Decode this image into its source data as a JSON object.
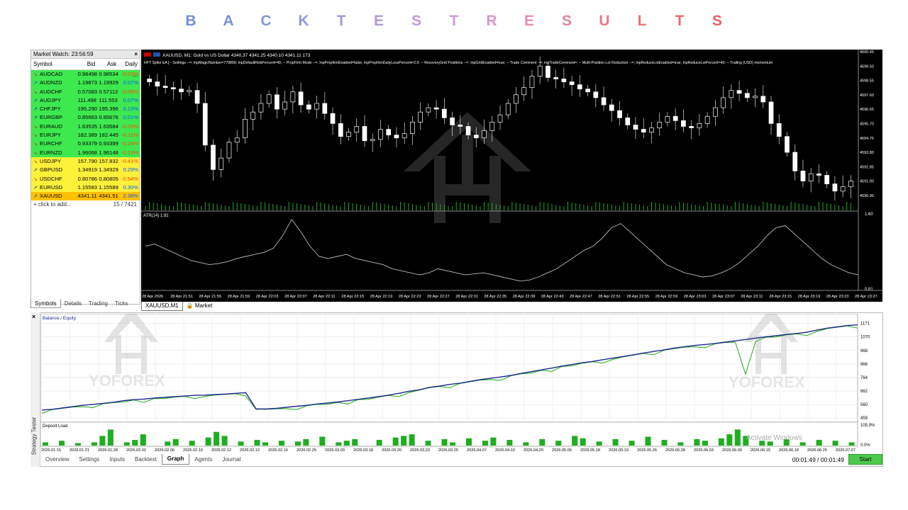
{
  "page_title": [
    "B",
    "A",
    "C",
    "K",
    "T",
    "E",
    "S",
    "T",
    "R",
    "E",
    "S",
    "U",
    "L",
    "T",
    "S"
  ],
  "title_colors": [
    "#6f8fd8",
    "#7593d8",
    "#8198d8",
    "#9097d8",
    "#9e98d8",
    "#b09ad8",
    "#c19ad8",
    "#cf99d8",
    "#d896cc",
    "#e08fb4",
    "#e4869c",
    "#e67c86",
    "#e87373",
    "#ea6a6a",
    "#ec6262"
  ],
  "market_watch": {
    "title": "Market Watch: 23:56:59",
    "close_icon": "×",
    "columns": [
      "Symbol",
      "Bid",
      "Ask",
      "Daily ..."
    ],
    "rows": [
      {
        "symbol": "AUDCAD",
        "bid": "0.98498",
        "ask": "0.98534",
        "chg": "-0.03%",
        "color": "g",
        "dir": "↘"
      },
      {
        "symbol": "AUDNZD",
        "bid": "1.19873",
        "ask": "1.19929",
        "chg": "0.07%",
        "color": "g",
        "dir": "↗"
      },
      {
        "symbol": "AUDCHF",
        "bid": "0.57083",
        "ask": "0.57112",
        "chg": "-0.06%",
        "color": "g",
        "dir": "↘"
      },
      {
        "symbol": "AUDJPY",
        "bid": "111.498",
        "ask": "111.553",
        "chg": "0.07%",
        "color": "g",
        "dir": "↗"
      },
      {
        "symbol": "CHFJPY",
        "bid": "195.290",
        "ask": "195.396",
        "chg": "0.13%",
        "color": "g",
        "dir": "↗"
      },
      {
        "symbol": "EURGBP",
        "bid": "0.85663",
        "ask": "0.85676",
        "chg": "0.01%",
        "color": "g",
        "dir": "↗"
      },
      {
        "symbol": "EURAUD",
        "bid": "1.63535",
        "ask": "1.63584",
        "chg": "-0.20%",
        "color": "g",
        "dir": "↘"
      },
      {
        "symbol": "EURJPY",
        "bid": "182.389",
        "ask": "182.445",
        "chg": "-0.11%",
        "color": "g",
        "dir": "↘"
      },
      {
        "symbol": "EURCHF",
        "bid": "0.93379",
        "ask": "0.93399",
        "chg": "-0.24%",
        "color": "g",
        "dir": "↘"
      },
      {
        "symbol": "EURNZD",
        "bid": "1.96068",
        "ask": "1.96148",
        "chg": "-0.13%",
        "color": "g",
        "dir": "↘"
      },
      {
        "symbol": "USDJPY",
        "bid": "157.790",
        "ask": "157.832",
        "chg": "-0.41%",
        "color": "y",
        "dir": "↘"
      },
      {
        "symbol": "GBPUSD",
        "bid": "1.34919",
        "ask": "1.34929",
        "chg": "0.29%",
        "color": "y",
        "dir": "↗"
      },
      {
        "symbol": "USDCHF",
        "bid": "0.80786",
        "ask": "0.80805",
        "chg": "-0.54%",
        "color": "y",
        "dir": "↘"
      },
      {
        "symbol": "EURUSD",
        "bid": "1.15583",
        "ask": "1.15589",
        "chg": "0.30%",
        "color": "y",
        "dir": "↗"
      },
      {
        "symbol": "XAUUSD",
        "bid": "4341.11",
        "ask": "4341.51",
        "chg": "2.38%",
        "color": "o",
        "dir": "↗"
      }
    ],
    "add_label": "+  click to add...",
    "count": "15 / 7421",
    "tabs": [
      "Symbols",
      "Details",
      "Trading",
      "Ticks"
    ]
  },
  "chart": {
    "header": "XAUUSD, M1:  Gold vs US Dollar  4340.37 4341.25 4340.10 4341.11  173",
    "ea_line": "HFT Spike EA [-- Settings --=; InpMagicNumber=779899; InpDefaultRiskPercent=40; -- PropFirm Mode --=; InpPropfirmEnabled=false; InpPropfirmDailyLossPercent=2.0; -- RecoveryGrid Positions --=; InpGridEnabled=true; -- Trade Comment --=; InpTradeComment=; -- Multi-Position Lot Reduction --=; InpReduceLotEnabled=true; InpReduceLotPercent=40; -- Trailing (USD) momentum",
    "price_labels": [
      "4600.45",
      "4599.50",
      "4598.55",
      "4597.60",
      "4596.65",
      "4595.70",
      "4594.75",
      "4593.80",
      "4592.85",
      "4591.90",
      "4590.95"
    ],
    "atr_label": "ATR(14) 1.92",
    "atr_scale": [
      "1.60",
      "0.81"
    ],
    "time_labels": [
      "28 Apr 2026",
      "28 Apr 21:51",
      "28 Apr 21:55",
      "28 Apr 21:59",
      "28 Apr 22:03",
      "28 Apr 22:07",
      "28 Apr 22:11",
      "28 Apr 22:15",
      "28 Apr 22:19",
      "28 Apr 22:23",
      "28 Apr 22:27",
      "28 Apr 22:31",
      "28 Apr 22:35",
      "28 Apr 22:39",
      "28 Apr 22:43",
      "28 Apr 22:47",
      "28 Apr 22:51",
      "28 Apr 22:55",
      "28 Apr 22:59",
      "28 Apr 23:03",
      "28 Apr 23:07",
      "28 Apr 23:11",
      "28 Apr 23:15",
      "28 Apr 23:19",
      "28 Apr 23:23",
      "28 Apr 23:27"
    ],
    "tabs": [
      "XAUUSD,M1",
      "Market"
    ],
    "candle_closes": [
      4598.7,
      4598.4,
      4598.3,
      4598.2,
      4598.0,
      4598.1,
      4597.2,
      4594.3,
      4592.6,
      4593.4,
      4594.5,
      4594.8,
      4596.1,
      4596.6,
      4597.2,
      4597.8,
      4596.8,
      4597.3,
      4598.0,
      4597.1,
      4596.8,
      4597.2,
      4596.5,
      4595.8,
      4594.9,
      4595.2,
      4595.6,
      4594.6,
      4594.7,
      4595.4,
      4595.0,
      4594.8,
      4595.1,
      4595.9,
      4596.6,
      4596.9,
      4596.8,
      4596.2,
      4595.7,
      4595.6,
      4595.0,
      4594.8,
      4595.3,
      4595.9,
      4596.4,
      4597.2,
      4597.8,
      4598.3,
      4599.1,
      4599.8,
      4599.0,
      4598.9,
      4598.7,
      4598.5,
      4598.2,
      4598.0,
      4597.6,
      4597.1,
      4596.7,
      4596.2,
      4595.7,
      4595.4,
      4595.2,
      4595.5,
      4595.9,
      4596.3,
      4596.0,
      4595.6,
      4595.5,
      4595.8,
      4596.3,
      4596.9,
      4597.6,
      4598.1,
      4597.9,
      4597.6,
      4597.7,
      4597.3,
      4595.8,
      4594.9,
      4593.8,
      4592.5,
      4591.8,
      4592.3,
      4592.2,
      4591.6,
      4591.1,
      4591.4,
      4591.8
    ]
  },
  "tester": {
    "side_label": "Strategy Tester",
    "close_icon": "×",
    "legend": "Balance / Equity",
    "balance_scale": [
      "1171",
      "1070",
      "968",
      "866",
      "764",
      "662",
      "560",
      "459"
    ],
    "deposit_label": "Deposit Load",
    "deposit_scale": [
      "105.9%",
      "0.0%"
    ],
    "dates": [
      "2026.01.15",
      "2026.01.21",
      "2026.01.28",
      "2026.02.02",
      "2026.02.06",
      "2026.02.10",
      "2026.02.12",
      "2026.02.12",
      "2026.02.16",
      "2026.02.25",
      "2026.03.09",
      "2026.03.18",
      "2026.03.20",
      "2026.03.23",
      "2026.03.25",
      "2026.04.07",
      "2026.04.10",
      "2026.04.20",
      "2026.05.06",
      "2026.05.18",
      "2026.05.19",
      "2026.05.26",
      "2026.05.28",
      "2026.06.03",
      "2026.06.09",
      "2026.06.15",
      "2026.06.18",
      "2026.06.25",
      "2026.07.07"
    ],
    "tabs": [
      "Overview",
      "Settings",
      "Inputs",
      "Backtest",
      "Graph",
      "Agents",
      "Journal"
    ],
    "active_tab": "Graph",
    "time": "00:01:49 / 00:01:49",
    "start_label": "Start",
    "watermark": "YOFOREX",
    "activate_text": "Activate Windows",
    "balance_points": [
      520,
      525,
      535,
      545,
      555,
      562,
      570,
      578,
      590,
      598,
      602,
      610,
      615,
      620,
      625,
      630,
      632,
      636,
      640,
      645,
      650,
      528,
      528,
      532,
      540,
      548,
      555,
      565,
      572,
      580,
      590,
      600,
      610,
      620,
      632,
      645,
      660,
      672,
      690,
      700,
      712,
      722,
      735,
      748,
      758,
      768,
      780,
      795,
      808,
      822,
      835,
      850,
      862,
      875,
      885,
      898,
      910,
      922,
      935,
      948,
      960,
      972,
      985,
      995,
      1005,
      1012,
      1020,
      1030,
      1040,
      1050,
      1060,
      1070,
      1078,
      1088,
      1095,
      1105,
      1120,
      1135,
      1145,
      1155,
      1160
    ],
    "deposit_loads": [
      20,
      0,
      30,
      0,
      15,
      0,
      20,
      60,
      100,
      0,
      20,
      35,
      70,
      0,
      0,
      25,
      40,
      0,
      30,
      0,
      50,
      85,
      60,
      0,
      25,
      0,
      35,
      20,
      0,
      30,
      0,
      25,
      40,
      0,
      55,
      0,
      20,
      30,
      40,
      0,
      0,
      35,
      0,
      50,
      60,
      70,
      0,
      30,
      0,
      40,
      20,
      0,
      45,
      0,
      30,
      50,
      0,
      35,
      0,
      20,
      0,
      40,
      0,
      30,
      0,
      60,
      45,
      0,
      25,
      0,
      40,
      0,
      30,
      0,
      55,
      0,
      35,
      0,
      20,
      0,
      40,
      30,
      0,
      45,
      70,
      100,
      60,
      0,
      30,
      25,
      0,
      40,
      0,
      20,
      0,
      35,
      0,
      30,
      0,
      20
    ]
  }
}
